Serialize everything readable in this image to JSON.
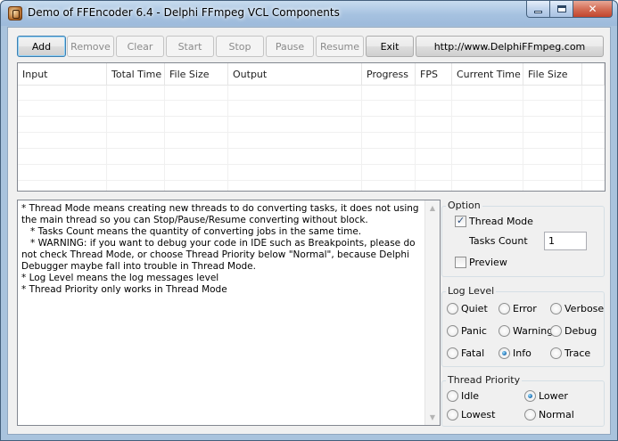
{
  "window": {
    "title": "Demo of FFEncoder 6.4 - Delphi FFmpeg VCL Components",
    "close_glyph": "✕"
  },
  "toolbar": {
    "add": "Add",
    "remove": "Remove",
    "clear": "Clear",
    "start": "Start",
    "stop": "Stop",
    "pause": "Pause",
    "resume": "Resume",
    "exit": "Exit",
    "url": "http://www.DelphiFFmpeg.com"
  },
  "list": {
    "columns": [
      "Input",
      "Total Time",
      "File Size",
      "Output",
      "Progress",
      "FPS",
      "Current Time",
      "File Size"
    ]
  },
  "memo": {
    "text": "* Thread Mode means creating new threads to do converting tasks, it does not using the main thread so you can Stop/Pause/Resume converting without block.\n   * Tasks Count means the quantity of converting jobs in the same time.\n   * WARNING: if you want to debug your code in IDE such as Breakpoints, please do not check Thread Mode, or choose Thread Priority below \"Normal\", because Delphi Debugger maybe fall into trouble in Thread Mode.\n* Log Level means the log messages level\n* Thread Priority only works in Thread Mode"
  },
  "option": {
    "title": "Option",
    "thread_mode": "Thread Mode",
    "thread_mode_checked": true,
    "tasks_count_label": "Tasks Count",
    "tasks_count_value": "1",
    "preview": "Preview",
    "preview_checked": false
  },
  "log_level": {
    "title": "Log Level",
    "selected": "Info",
    "options": [
      "Quiet",
      "Error",
      "Verbose",
      "Panic",
      "Warning",
      "Debug",
      "Fatal",
      "Info",
      "Trace"
    ]
  },
  "thread_priority": {
    "title": "Thread Priority",
    "selected": "Lower",
    "options": [
      "Idle",
      "Lower",
      "Lowest",
      "Normal"
    ]
  },
  "scrollbar": {
    "up_glyph": "▲",
    "down_glyph": "▼"
  }
}
